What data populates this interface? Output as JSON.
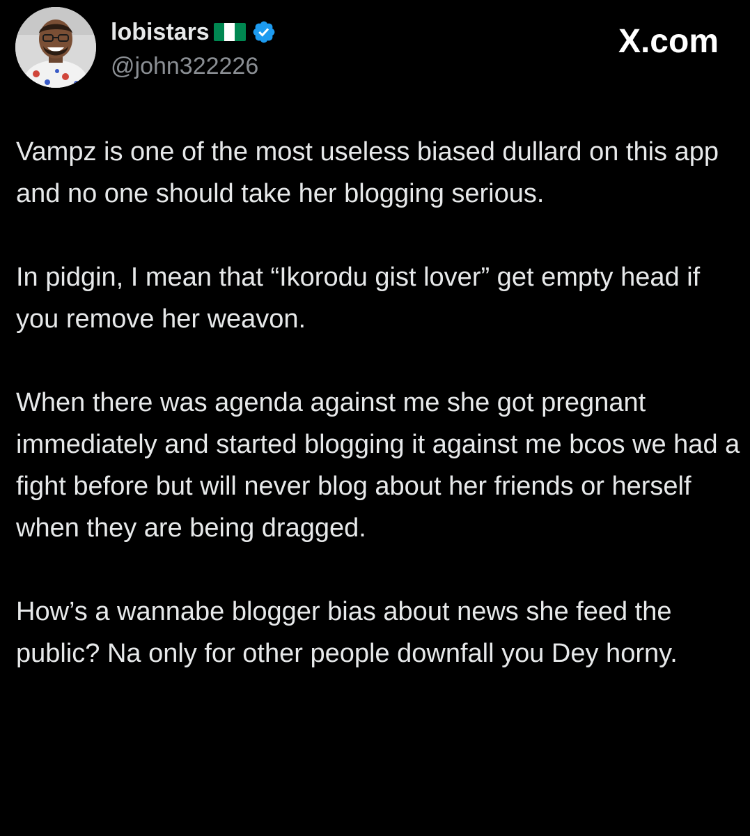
{
  "header": {
    "display_name": "lobistars",
    "flag_icon": "nigeria-flag-icon",
    "verified_icon": "verified-badge-icon",
    "handle": "@john322226",
    "brand": "X.com"
  },
  "colors": {
    "background": "#000000",
    "text": "#e7e9ea",
    "secondary_text": "#8b8f94",
    "verified": "#1d9bf0",
    "flag_green": "#008751",
    "flag_white": "#ffffff"
  },
  "tweet": {
    "paragraphs": [
      "Vampz is one of the most useless biased dullard on this app and no one should take her blogging serious.",
      "In pidgin, I mean that “Ikorodu gist lover” get empty head if you remove her weavon.",
      "When there was agenda against me she got pregnant immediately and started blogging it against me bcos we had a fight before but will never blog about her friends or herself when they are being dragged.",
      "How’s a wannabe blogger bias about news she feed the public? Na only for other people downfall you Dey horny."
    ]
  }
}
